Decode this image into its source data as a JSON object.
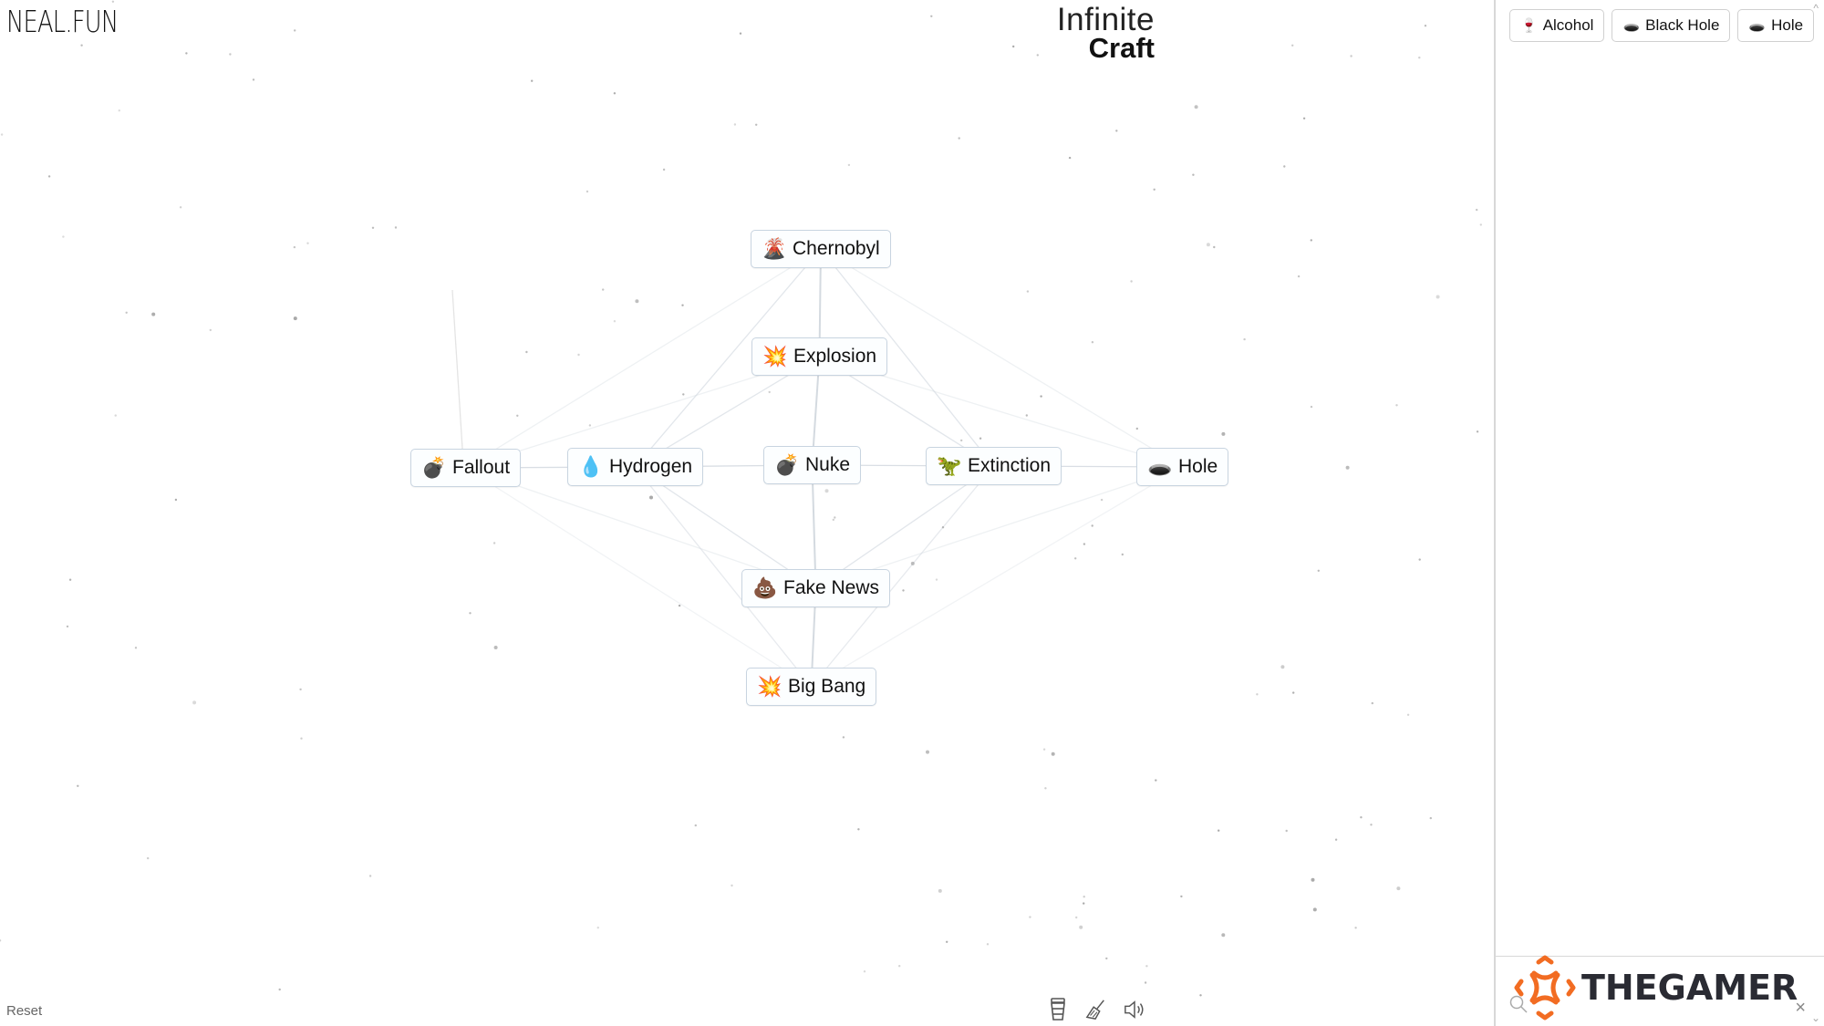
{
  "header": {
    "site_logo": "NEAL.FUN",
    "title_line1": "Infinite",
    "title_line2": "Craft"
  },
  "canvas": {
    "nodes": [
      {
        "id": "chernobyl",
        "label": "Chernobyl",
        "emoji": "🌋",
        "icon": "volcano-icon"
      },
      {
        "id": "explosion",
        "label": "Explosion",
        "emoji": "💥",
        "icon": "explosion-icon"
      },
      {
        "id": "fallout",
        "label": "Fallout",
        "emoji": "💣",
        "icon": "bomb-icon"
      },
      {
        "id": "hydrogen",
        "label": "Hydrogen",
        "emoji": "💧",
        "icon": "droplet-icon"
      },
      {
        "id": "nuke",
        "label": "Nuke",
        "emoji": "💣",
        "icon": "bomb-icon"
      },
      {
        "id": "extinction",
        "label": "Extinction",
        "emoji": "🦖",
        "icon": "dinosaur-icon"
      },
      {
        "id": "hole",
        "label": "Hole",
        "emoji": "🕳️",
        "icon": "hole-icon"
      },
      {
        "id": "fake_news",
        "label": "Fake News",
        "emoji": "💩",
        "icon": "poop-icon"
      },
      {
        "id": "big_bang",
        "label": "Big Bang",
        "emoji": "💥",
        "icon": "explosion-icon"
      }
    ],
    "reset_label": "Reset"
  },
  "toolbar": {
    "icons": [
      "cup-icon",
      "broom-icon",
      "sound-icon"
    ]
  },
  "sidebar": {
    "items": [
      {
        "label": "Alcohol",
        "emoji": "🍷",
        "icon": "wine-glass-icon"
      },
      {
        "label": "Black Hole",
        "emoji": "🕳️",
        "icon": "hole-icon"
      },
      {
        "label": "Hole",
        "emoji": "🕳️",
        "icon": "hole-icon"
      }
    ],
    "search_placeholder": ""
  },
  "watermark": {
    "text": "THEGAMER",
    "accent_color": "#f26c22"
  },
  "colors": {
    "node_border": "#c8d4e0",
    "line": "#cfd6dd",
    "dot": "#9a9a9a"
  }
}
